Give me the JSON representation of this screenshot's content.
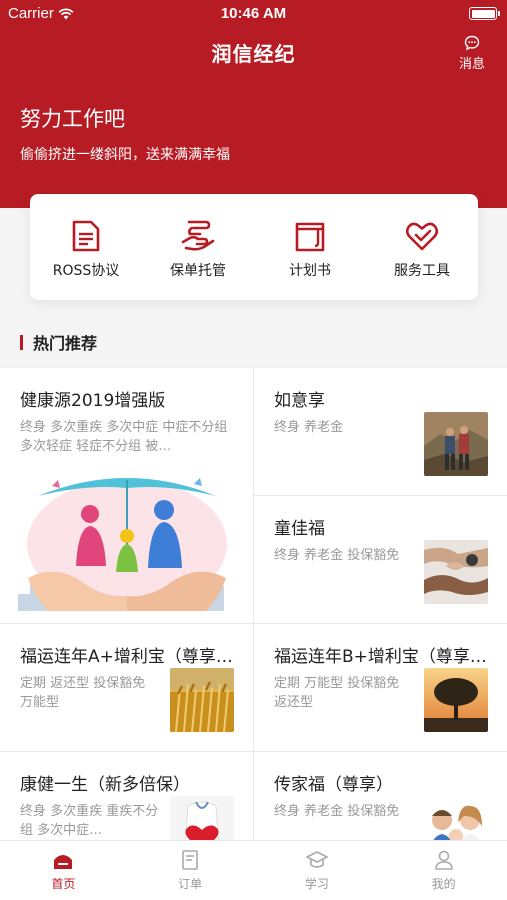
{
  "status": {
    "carrier": "Carrier",
    "time": "10:46 AM"
  },
  "nav": {
    "title": "润信经纪",
    "message_label": "消息"
  },
  "hero": {
    "title": "努力工作吧",
    "subtitle": "偷偷挤进一缕斜阳，送来满满幸福"
  },
  "quick": [
    {
      "label": "ROSS协议",
      "icon": "document-icon"
    },
    {
      "label": "保单托管",
      "icon": "hand-icon"
    },
    {
      "label": "计划书",
      "icon": "folder-icon"
    },
    {
      "label": "服务工具",
      "icon": "heart-icon"
    }
  ],
  "section": {
    "title": "热门推荐"
  },
  "products": [
    {
      "name": "健康源2019增强版",
      "tags": "终身 多次重疾 多次中症 中症不分组 多次轻症 轻症不分组 被…"
    },
    {
      "name": "如意享",
      "tags": "终身 养老金"
    },
    {
      "name": "童佳福",
      "tags": "终身 养老金 投保豁免"
    },
    {
      "name": "福运连年A+增利宝（尊享…",
      "tags": "定期 返还型 投保豁免 万能型"
    },
    {
      "name": "福运连年B+增利宝（尊享…",
      "tags": "定期 万能型 投保豁免 返还型"
    },
    {
      "name": "康健一生（新多倍保）",
      "tags": "终身 多次重疾 重疾不分组 多次中症…"
    },
    {
      "name": "传家福（尊享）",
      "tags": "终身 养老金 投保豁免"
    }
  ],
  "tabs": [
    {
      "label": "首页",
      "active": true
    },
    {
      "label": "订单",
      "active": false
    },
    {
      "label": "学习",
      "active": false
    },
    {
      "label": "我的",
      "active": false
    }
  ],
  "colors": {
    "brand": "#b71c24",
    "tag_gray": "#999999"
  }
}
